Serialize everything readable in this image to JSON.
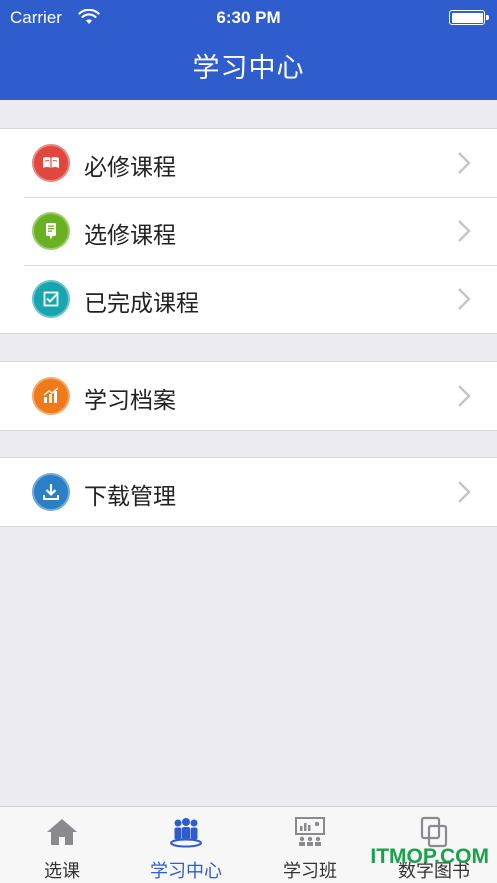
{
  "status_bar": {
    "carrier": "Carrier",
    "time": "6:30 PM"
  },
  "nav": {
    "title": "学习中心"
  },
  "groups": [
    {
      "items": [
        {
          "label": "必修课程",
          "icon": "book-icon",
          "color": "#e0473f"
        },
        {
          "label": "选修课程",
          "icon": "tablet-icon",
          "color": "#6ab023"
        },
        {
          "label": "已完成课程",
          "icon": "checklist-icon",
          "color": "#19a5b0"
        }
      ]
    },
    {
      "items": [
        {
          "label": "学习档案",
          "icon": "bar-chart-icon",
          "color": "#f07a1a"
        }
      ]
    },
    {
      "items": [
        {
          "label": "下载管理",
          "icon": "download-icon",
          "color": "#2b7fc4"
        }
      ]
    }
  ],
  "tabs": [
    {
      "label": "选课",
      "icon": "home-icon",
      "active": false
    },
    {
      "label": "学习中心",
      "icon": "people-icon",
      "active": true
    },
    {
      "label": "学习班",
      "icon": "classroom-icon",
      "active": false
    },
    {
      "label": "数字图书",
      "icon": "copy-icon",
      "active": false
    }
  ],
  "watermark": "ITMOP.COM",
  "colors": {
    "header": "#2f5dcd",
    "background": "#ebebf1",
    "active_tab": "#2f5dcd"
  }
}
